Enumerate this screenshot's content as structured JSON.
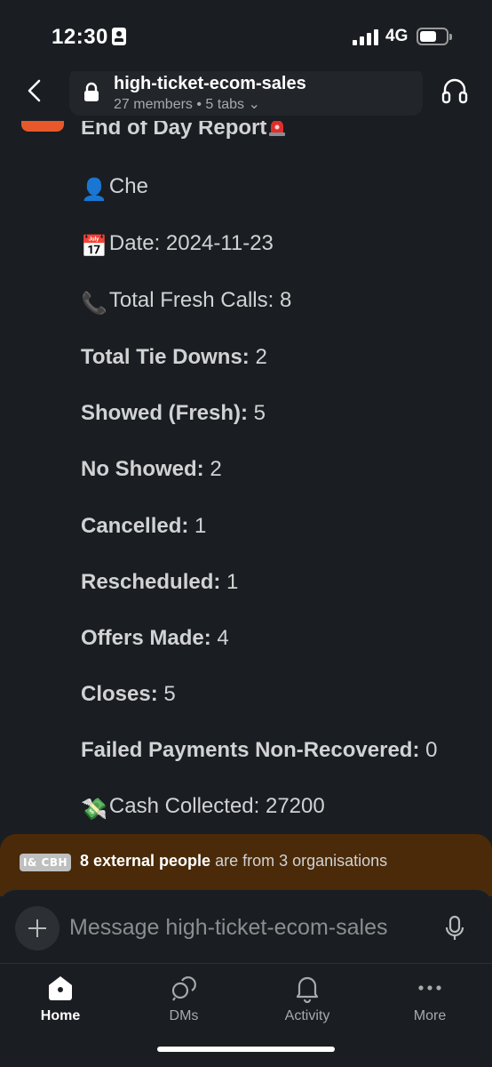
{
  "status_bar": {
    "time": "12:30",
    "network": "4G"
  },
  "header": {
    "channel_name": "high-ticket-ecom-sales",
    "subtitle": "27 members • 5 tabs ⌄"
  },
  "message": {
    "title": "End of Day Report",
    "lines": [
      {
        "emoji": "👤",
        "bold": "",
        "text": "Che"
      },
      {
        "emoji": "📅",
        "bold": "",
        "text": "Date: 2024-11-23"
      },
      {
        "emoji": "📞",
        "bold": "",
        "text": "Total Fresh Calls: 8"
      },
      {
        "emoji": "",
        "bold": "Total Tie Downs:",
        "text": " 2"
      },
      {
        "emoji": "",
        "bold": "Showed (Fresh):",
        "text": " 5"
      },
      {
        "emoji": "",
        "bold": "No Showed:",
        "text": " 2"
      },
      {
        "emoji": "",
        "bold": "Cancelled:",
        "text": " 1"
      },
      {
        "emoji": "",
        "bold": "Rescheduled:",
        "text": " 1"
      },
      {
        "emoji": "",
        "bold": "Offers Made:",
        "text": " 4"
      },
      {
        "emoji": "",
        "bold": "Closes:",
        "text": " 5"
      },
      {
        "emoji": "",
        "bold": "Failed Payments Non-Recovered:",
        "text": " 0"
      },
      {
        "emoji": "💸",
        "bold": "",
        "text": "Cash Collected: 27200"
      }
    ]
  },
  "external_banner": {
    "badge": "I& CBH",
    "bold": "8 external people",
    "text": " are from 3 organisations"
  },
  "composer": {
    "placeholder": "Message high-ticket-ecom-sales"
  },
  "nav": {
    "items": [
      {
        "label": "Home",
        "icon": "home-icon",
        "active": true
      },
      {
        "label": "DMs",
        "icon": "dms-icon",
        "active": false
      },
      {
        "label": "Activity",
        "icon": "bell-icon",
        "active": false
      },
      {
        "label": "More",
        "icon": "more-icon",
        "active": false
      }
    ]
  },
  "colors": {
    "background": "#1a1d21",
    "banner": "#4a2a09",
    "avatar_accent": "#e8582a"
  }
}
